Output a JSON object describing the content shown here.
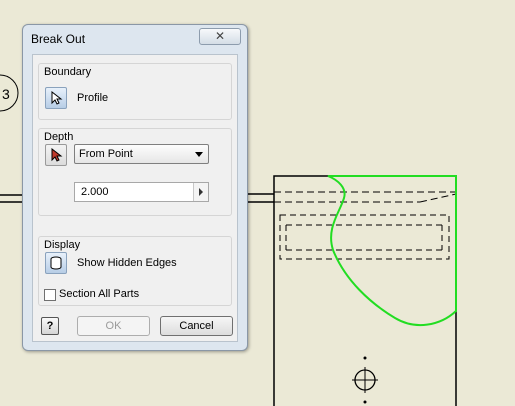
{
  "drawing": {
    "balloon_label": "3",
    "colors": {
      "background": "#ebe9d6",
      "line": "#000000",
      "boundary": "#22dd22"
    }
  },
  "dialog": {
    "title": "Break Out",
    "close_icon": "close-icon",
    "boundary": {
      "label": "Boundary",
      "profile_label": "Profile",
      "icon": "cursor-select-icon"
    },
    "depth": {
      "label": "Depth",
      "icon": "cursor-select-icon",
      "mode_value": "From Point",
      "distance_value": "2.000"
    },
    "display": {
      "label": "Display",
      "hidden_edges_label": "Show Hidden Edges",
      "hidden_edges_icon": "cylinder-icon",
      "section_all_label": "Section All Parts",
      "section_all_checked": false
    },
    "footer": {
      "help_label": "?",
      "ok_label": "OK",
      "cancel_label": "Cancel"
    }
  }
}
